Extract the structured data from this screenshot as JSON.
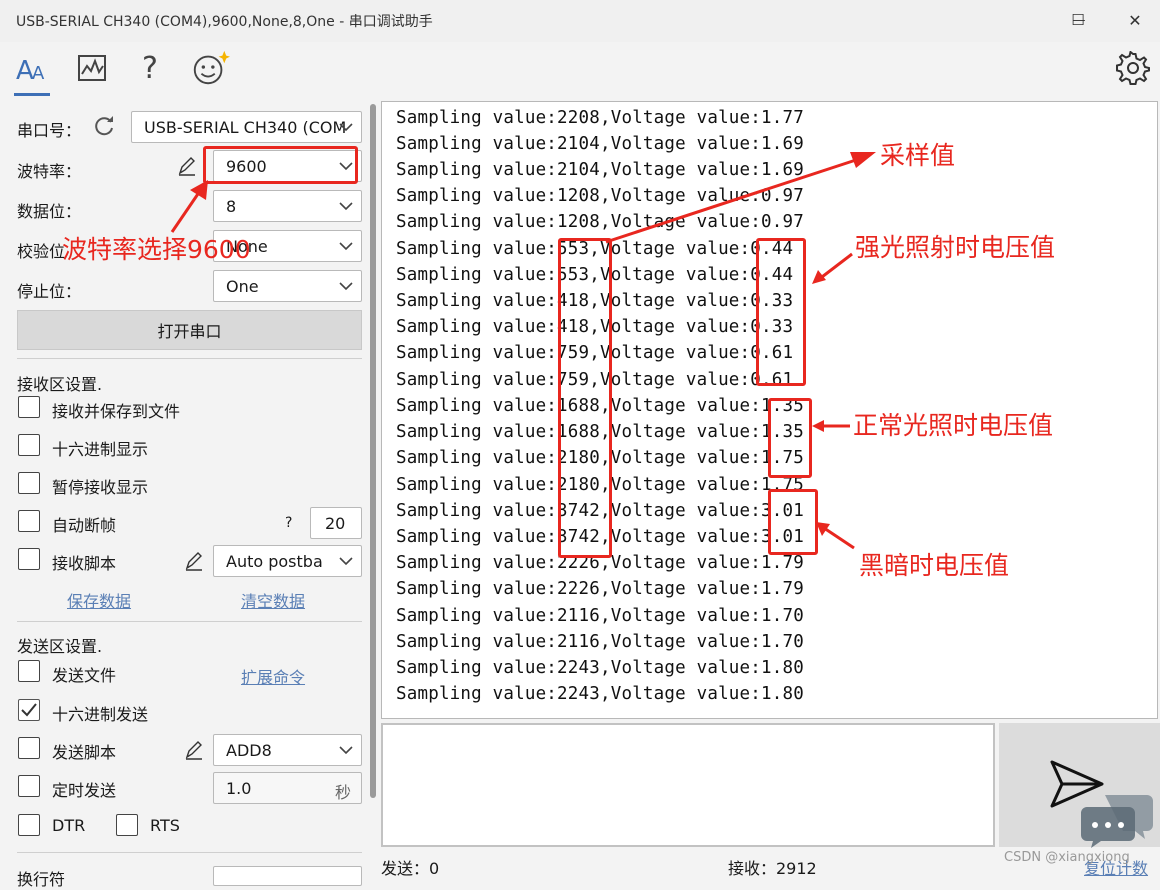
{
  "window": {
    "title": "USB-SERIAL CH340 (COM4),9600,None,8,One - 串口调试助手",
    "minimize": "—",
    "maximize": "☐",
    "close": "✕"
  },
  "toolbar": {
    "items": [
      "font-icon",
      "chart-icon",
      "help-icon",
      "emoji-icon"
    ],
    "help_glyph": "?",
    "settings_icon": "gear-icon",
    "accent": "#3d6fb6"
  },
  "serial": {
    "port_label": "串口号：",
    "port_value": "USB-SERIAL CH340 (COM",
    "baud_label": "波特率：",
    "baud_value": "9600",
    "databits_label": "数据位：",
    "databits_value": "8",
    "parity_label": "校验位",
    "parity_value": "None",
    "stopbits_label": "停止位：",
    "stopbits_value": "One",
    "open_button": "打开串口"
  },
  "receive_settings": {
    "heading": "接收区设置.",
    "save_to_file": "接收并保存到文件",
    "hex_display": "十六进制显示",
    "pause_display": "暂停接收显示",
    "auto_frame": "自动断帧",
    "auto_frame_help": "?",
    "auto_frame_value": "20",
    "recv_script": "接收脚本",
    "recv_script_value": "Auto postba",
    "save_data": "保存数据",
    "clear_data": "清空数据"
  },
  "send_settings": {
    "heading": "发送区设置.",
    "send_file": "发送文件",
    "extend_cmd": "扩展命令",
    "hex_send": "十六进制发送",
    "hex_send_checked": true,
    "send_script": "发送脚本",
    "send_script_value": "ADD8",
    "timed_send": "定时发送",
    "timed_value": "1.0",
    "timed_unit": "秒",
    "dtr": "DTR",
    "rts": "RTS",
    "line_ending_label": "换行符"
  },
  "receive_lines": [
    "Sampling value:2208,Voltage value:1.77",
    "Sampling value:2104,Voltage value:1.69",
    "Sampling value:2104,Voltage value:1.69",
    "Sampling value:1208,Voltage value:0.97",
    "Sampling value:1208,Voltage value:0.97",
    "Sampling value:553,Voltage value:0.44",
    "Sampling value:553,Voltage value:0.44",
    "Sampling value:418,Voltage value:0.33",
    "Sampling value:418,Voltage value:0.33",
    "Sampling value:759,Voltage value:0.61",
    "Sampling value:759,Voltage value:0.61",
    "Sampling value:1688,Voltage value:1.35",
    "Sampling value:1688,Voltage value:1.35",
    "Sampling value:2180,Voltage value:1.75",
    "Sampling value:2180,Voltage value:1.75",
    "Sampling value:3742,Voltage value:3.01",
    "Sampling value:3742,Voltage value:3.01",
    "Sampling value:2226,Voltage value:1.79",
    "Sampling value:2226,Voltage value:1.79",
    "Sampling value:2116,Voltage value:1.70",
    "Sampling value:2116,Voltage value:1.70",
    "Sampling value:2243,Voltage value:1.80",
    "Sampling value:2243,Voltage value:1.80"
  ],
  "status": {
    "sent": "发送：0",
    "received": "接收：2912",
    "reset_count": "复位计数",
    "watermark": "CSDN @xiangxiong"
  },
  "annotations": {
    "baud_note": "波特率选择9600",
    "sample_note": "采样值",
    "strong_light": "强光照射时电压值",
    "normal_light": "正常光照时电压值",
    "dark": "黑暗时电压值",
    "color": "#e8271f"
  }
}
